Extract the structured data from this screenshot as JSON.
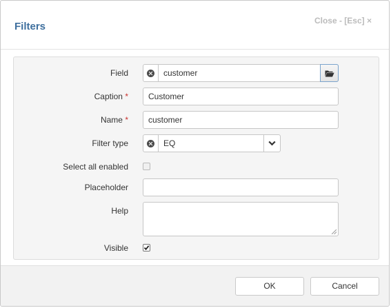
{
  "dialog": {
    "title": "Filters",
    "close_label": "Close - [Esc] ×"
  },
  "form": {
    "field": {
      "label": "Field",
      "value": "customer",
      "icon": "clear-icon",
      "browse_icon": "folder-open-icon"
    },
    "caption": {
      "label": "Caption",
      "required_mark": "*",
      "value": "Customer"
    },
    "name": {
      "label": "Name",
      "required_mark": "*",
      "value": "customer"
    },
    "filter_type": {
      "label": "Filter type",
      "value": "EQ",
      "icon": "clear-icon",
      "dropdown_icon": "chevron-down-icon"
    },
    "select_all_enabled": {
      "label": "Select all enabled",
      "checked": false
    },
    "placeholder": {
      "label": "Placeholder",
      "value": ""
    },
    "help": {
      "label": "Help",
      "value": ""
    },
    "visible": {
      "label": "Visible",
      "checked": true
    }
  },
  "footer": {
    "ok_label": "OK",
    "cancel_label": "Cancel"
  },
  "colors": {
    "title": "#3e6f9e",
    "required": "#c9302c",
    "panel_bg": "#f5f5f5",
    "footer_bg": "#f2f2f2"
  }
}
